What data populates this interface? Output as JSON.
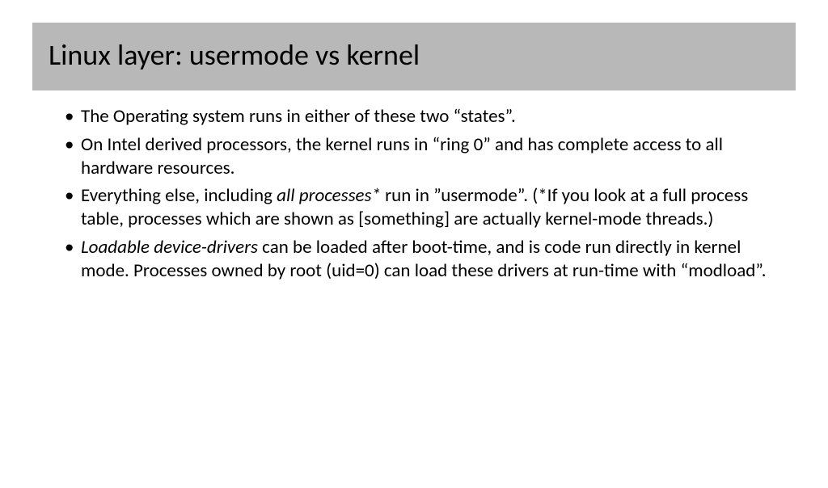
{
  "title": "Linux layer:  usermode vs kernel",
  "bullets": {
    "b1": "The Operating system runs in either of these two “states”.",
    "b2": "On Intel derived processors, the kernel runs in “ring 0” and has complete access to all hardware resources.",
    "b3_pre": "Everything else, including ",
    "b3_em": "all processes*",
    "b3_post": " run in ”usermode”. (*If you look at a full process table, processes which are shown as [something] are actually kernel-mode threads.)",
    "b4_em": "Loadable device-drivers",
    "b4_post": " can be loaded after boot-time, and is code run directly in kernel mode. Processes owned by root (uid=0) can load these drivers at run-time with “modload”."
  }
}
